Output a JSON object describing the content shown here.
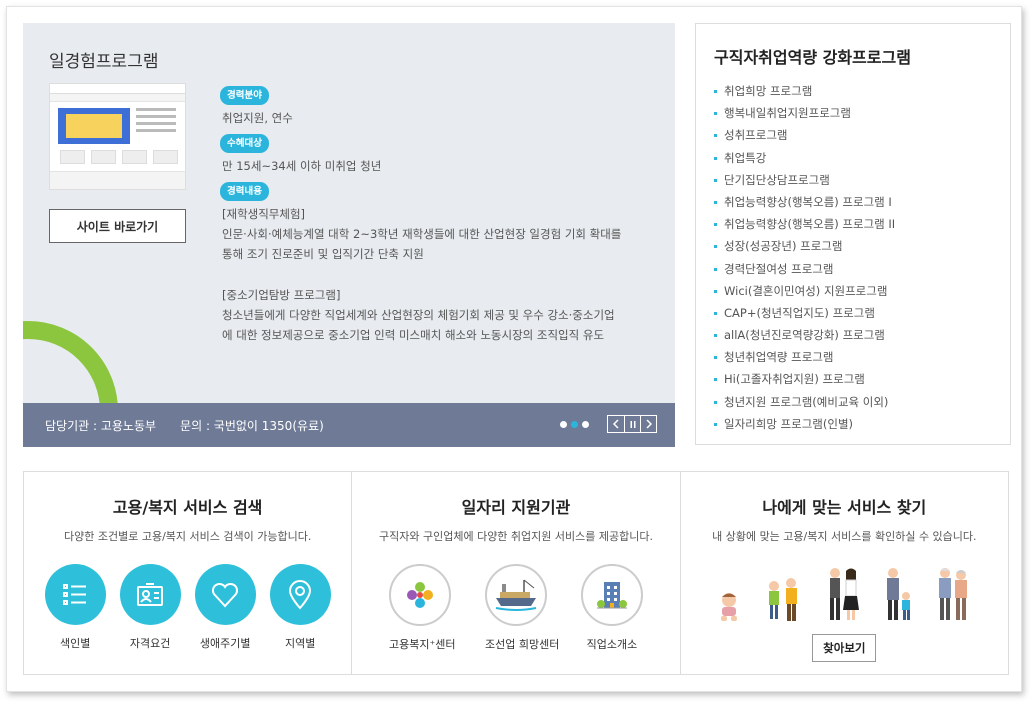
{
  "program": {
    "title": "일경험프로그램",
    "site_button": "사이트 바로가기",
    "field_badge": "경력분야",
    "field_value": "취업지원, 연수",
    "target_badge": "수혜대상",
    "target_value": "만 15세~34세 이하 미취업 청년",
    "content_badge": "경력내용",
    "content_lines_1": [
      "[재학생직무체험]",
      "인문·사회·예체능계열 대학 2~3학년 재학생들에 대한 산업현장 일경험 기회 확대를",
      "통해 조기 진로준비 및 입직기간 단축 지원"
    ],
    "content_lines_2": [
      "[중소기업탐방 프로그램]",
      "청소년들에게 다양한 직업세계와 산업현장의 체험기회 제공 및 우수 강소·중소기업",
      "에 대한 정보제공으로 중소기업 인력 미스매치 해소와 노동시장의 조직입직 유도"
    ],
    "footer_agency": "담당기관 : 고용노동부",
    "footer_contact": "문의 : 국번없이 1350(유료)",
    "accent_color": "#2bb5dc",
    "footer_color": "#6e7a96"
  },
  "side": {
    "title": "구직자취업역량 강화프로그램",
    "items": [
      "취업희망 프로그램",
      "행복내일취업지원프로그램",
      "성취프로그램",
      "취업특강",
      "단기집단상담프로그램",
      "취업능력향상(행복오름) 프로그램 I",
      "취업능력향상(행복오름) 프로그램 II",
      "성장(성공장년) 프로그램",
      "경력단절여성 프로그램",
      "Wici(결혼이민여성) 지원프로그램",
      "CAP+(청년직업지도) 프로그램",
      "allA(청년진로역량강화) 프로그램",
      "청년취업역량 프로그램",
      "Hi(고졸자취업지원) 프로그램",
      "청년지원 프로그램(예비교육 이외)",
      "일자리희망 프로그램(인별)"
    ]
  },
  "services": {
    "search": {
      "title": "고용/복지 서비스 검색",
      "desc": "다양한 조건별로 고용/복지 서비스 검색이 가능합니다.",
      "items": [
        "색인별",
        "자격요건",
        "생애주기별",
        "지역별"
      ]
    },
    "agency": {
      "title": "일자리 지원기관",
      "desc": "구직자와 구인업체에 다양한 취업지원 서비스를 제공합니다.",
      "items": [
        "고용복지⁺센터",
        "조선업 희망센터",
        "직업소개소"
      ]
    },
    "match": {
      "title": "나에게 맞는 서비스 찾기",
      "desc": "내 상황에 맞는 고용/복지 서비스를 확인하실 수 있습니다.",
      "button": "찾아보기"
    }
  }
}
